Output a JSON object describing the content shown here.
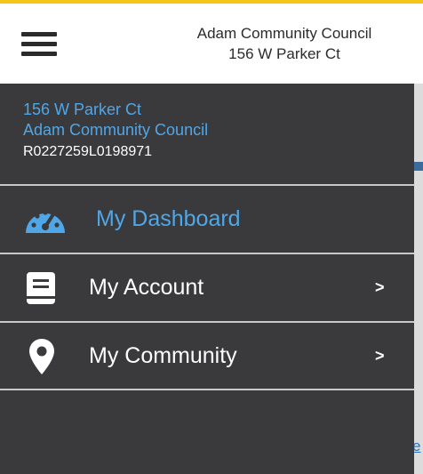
{
  "header": {
    "council": "Adam Community Council",
    "address": "156 W Parker Ct"
  },
  "account": {
    "address": "156 W Parker Ct",
    "council": "Adam Community Council",
    "id": "R0227259L0198971"
  },
  "menu": {
    "items": [
      {
        "label": "My Dashboard",
        "icon": "dashboard-gauge-icon",
        "active": true
      },
      {
        "label": "My Account",
        "icon": "book-icon",
        "chevron": ">"
      },
      {
        "label": "My Community",
        "icon": "map-pin-icon",
        "chevron": ">"
      }
    ]
  },
  "colors": {
    "accent": "#f5c518",
    "link_blue": "#4fa7e8",
    "drawer_bg": "#3a3a3d"
  }
}
